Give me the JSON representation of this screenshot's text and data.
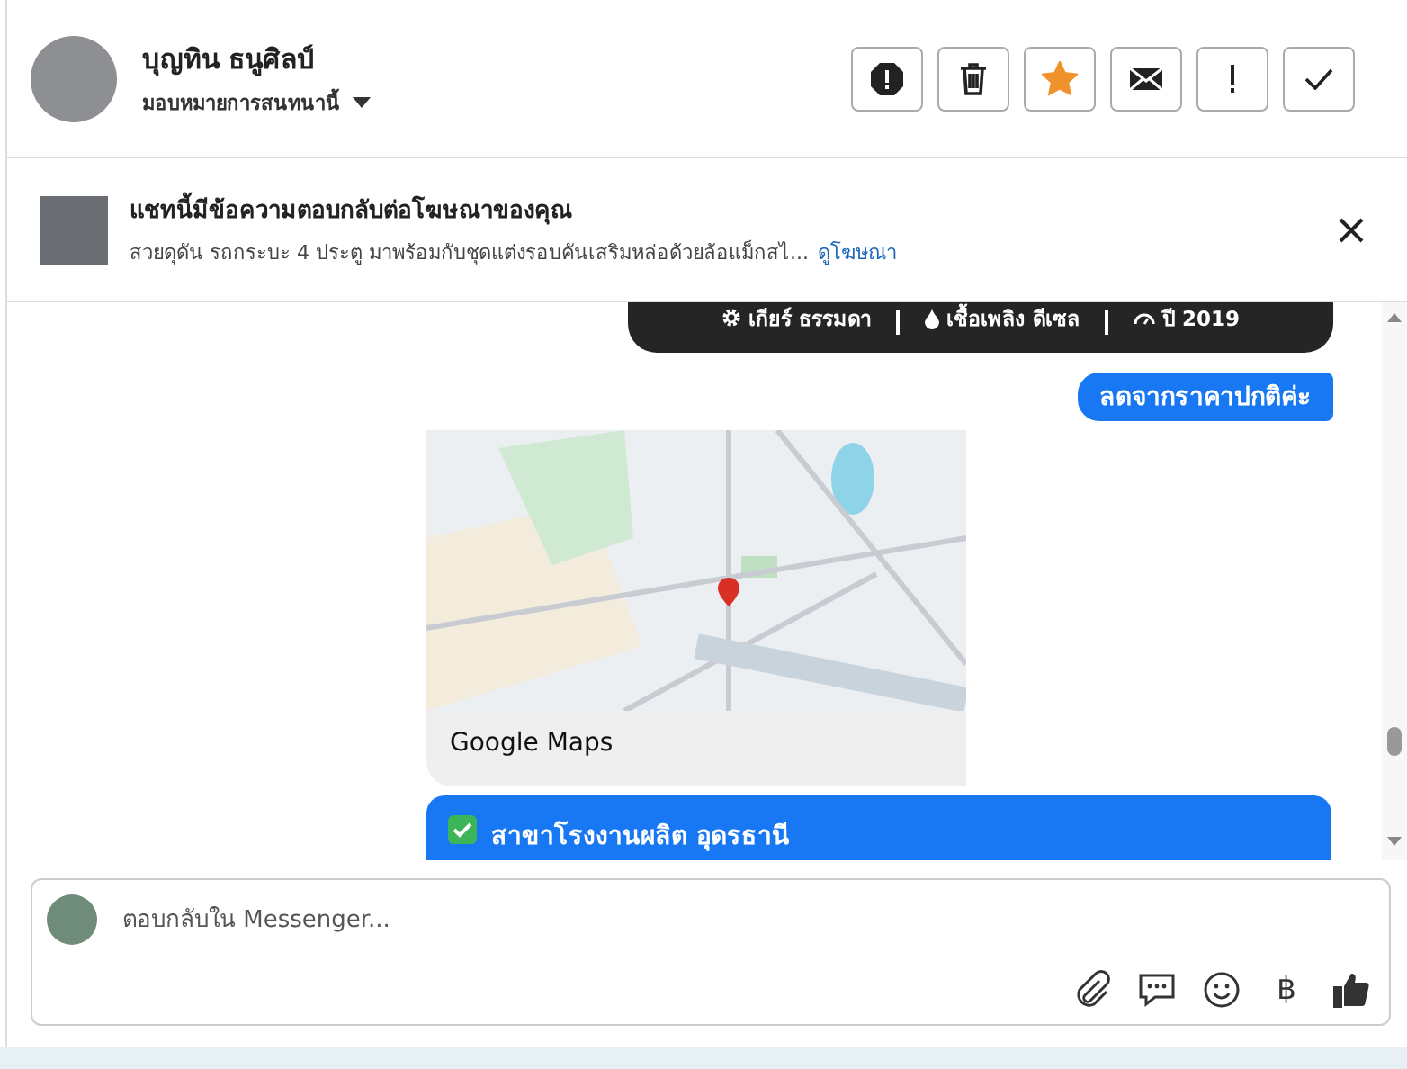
{
  "header": {
    "name": "บุญทิน ธนูศิลป์",
    "assign": "มอบหมายการสนทนานี้",
    "starred": true
  },
  "ad_banner": {
    "title": "แชทนี้มีข้อความตอบกลับต่อโฆษณาของคุณ",
    "description": "สวยดุดัน รถกระบะ 4 ประตู มาพร้อมกับชุดแต่งรอบคันเสริมหล่อด้วยล้อแม็กสไ...",
    "link": "ดูโฆษณา"
  },
  "messages": [
    {
      "kind": "spec_card",
      "specs": [
        {
          "kind": "gear",
          "text": "เกียร์ ธรรมดา"
        },
        {
          "kind": "fuel",
          "text": "เชื้อเพลิง ดีเซล"
        },
        {
          "kind": "gauge",
          "text": "ปี 2019"
        }
      ]
    },
    {
      "kind": "outgoing",
      "text": "ลดจากราคาปกติค่ะ"
    },
    {
      "kind": "map",
      "caption": "Google Maps"
    },
    {
      "kind": "outgoing_cut",
      "text": "สาขาโรงงานผลิต อุดรธานี"
    }
  ],
  "composer": {
    "placeholder": "ตอบกลับใน Messenger...",
    "currency": "฿"
  }
}
